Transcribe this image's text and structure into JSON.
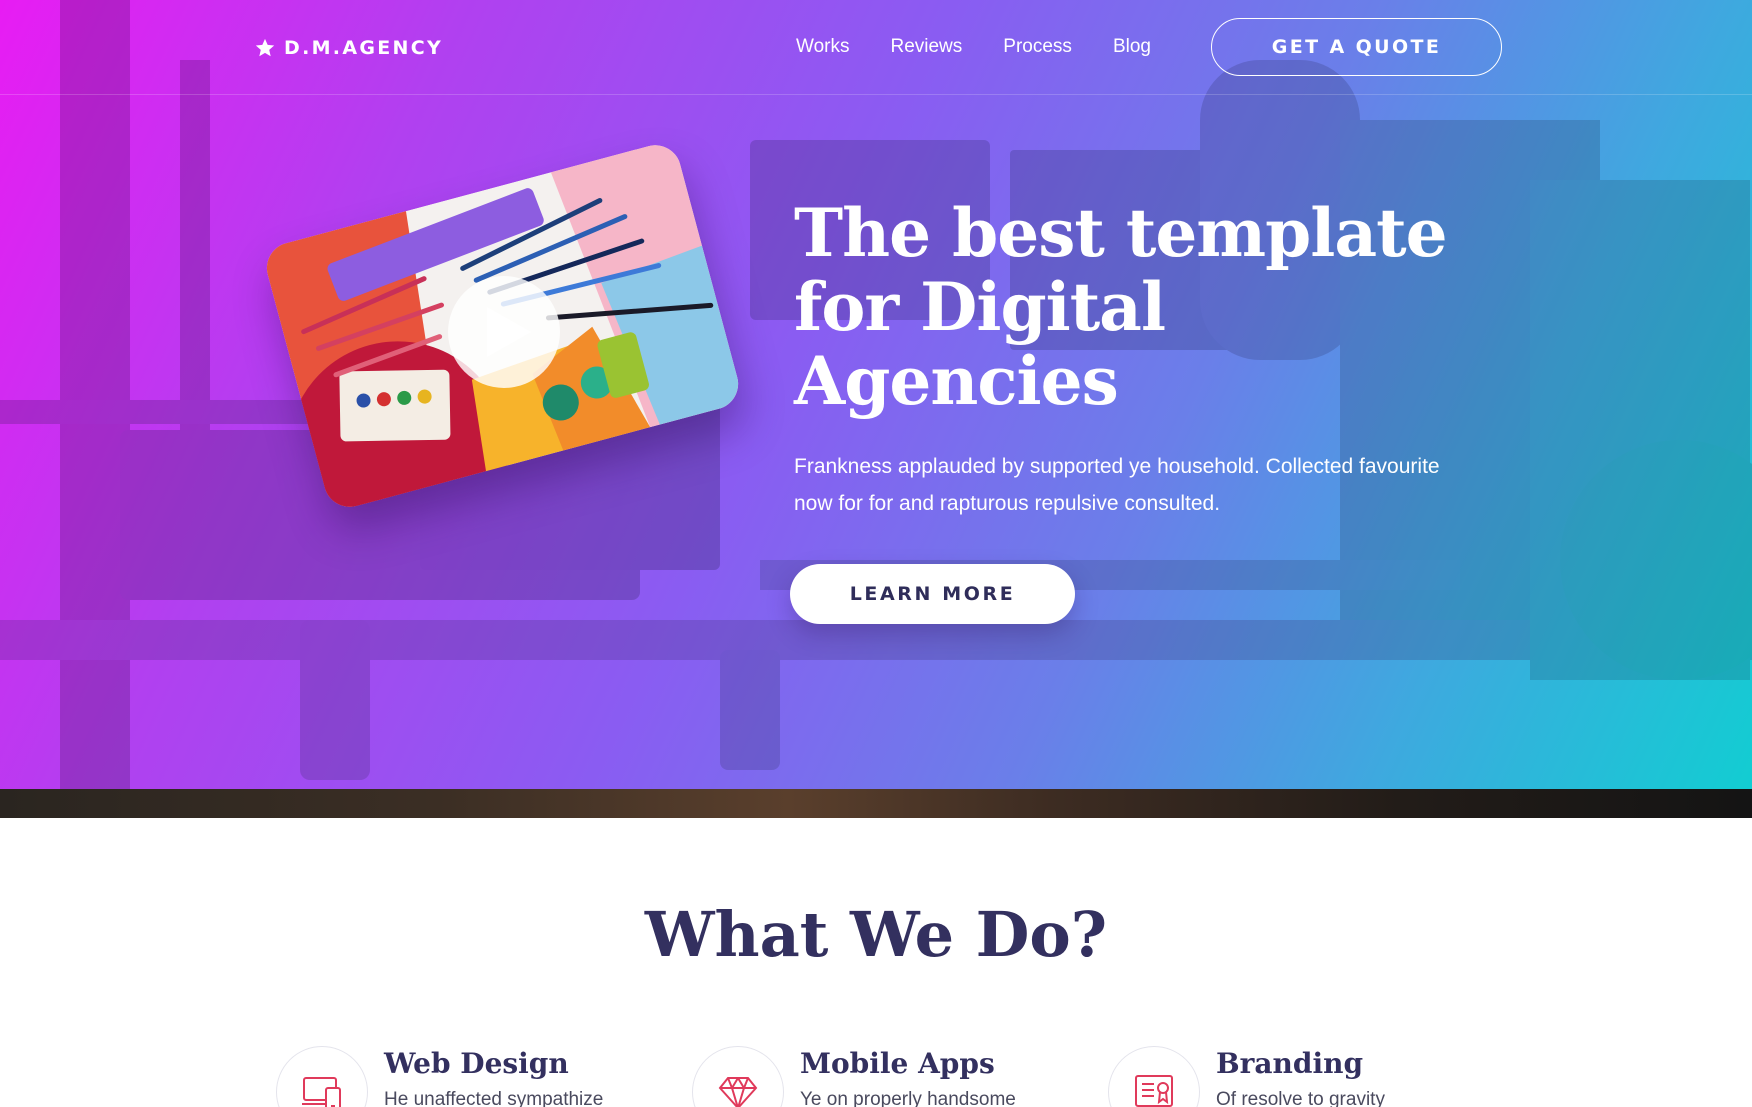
{
  "brand": {
    "name": "D.M.AGENCY",
    "icon": "star-icon"
  },
  "nav": {
    "links": [
      "Works",
      "Reviews",
      "Process",
      "Blog"
    ],
    "cta": "GET A QUOTE"
  },
  "hero": {
    "title": "The best template for Digital Agencies",
    "subtitle": "Frankness applauded by supported ye household. Collected favourite now for for and rapturous repulsive consulted.",
    "button": "LEARN MORE",
    "video_icon": "play-icon",
    "gradient": [
      "#e81cf3",
      "#8a5cf2",
      "#12cdd2"
    ]
  },
  "services": {
    "title": "What We Do?",
    "items": [
      {
        "title": "Web Design",
        "desc": "He unaffected sympathize",
        "icon": "devices-icon"
      },
      {
        "title": "Mobile Apps",
        "desc": "Ye on properly handsome",
        "icon": "diamond-icon"
      },
      {
        "title": "Branding",
        "desc": "Of resolve to gravity",
        "icon": "certificate-icon"
      }
    ]
  },
  "colors": {
    "heading": "#33305f",
    "icon_accent": "#e03a5b",
    "white": "#ffffff"
  }
}
